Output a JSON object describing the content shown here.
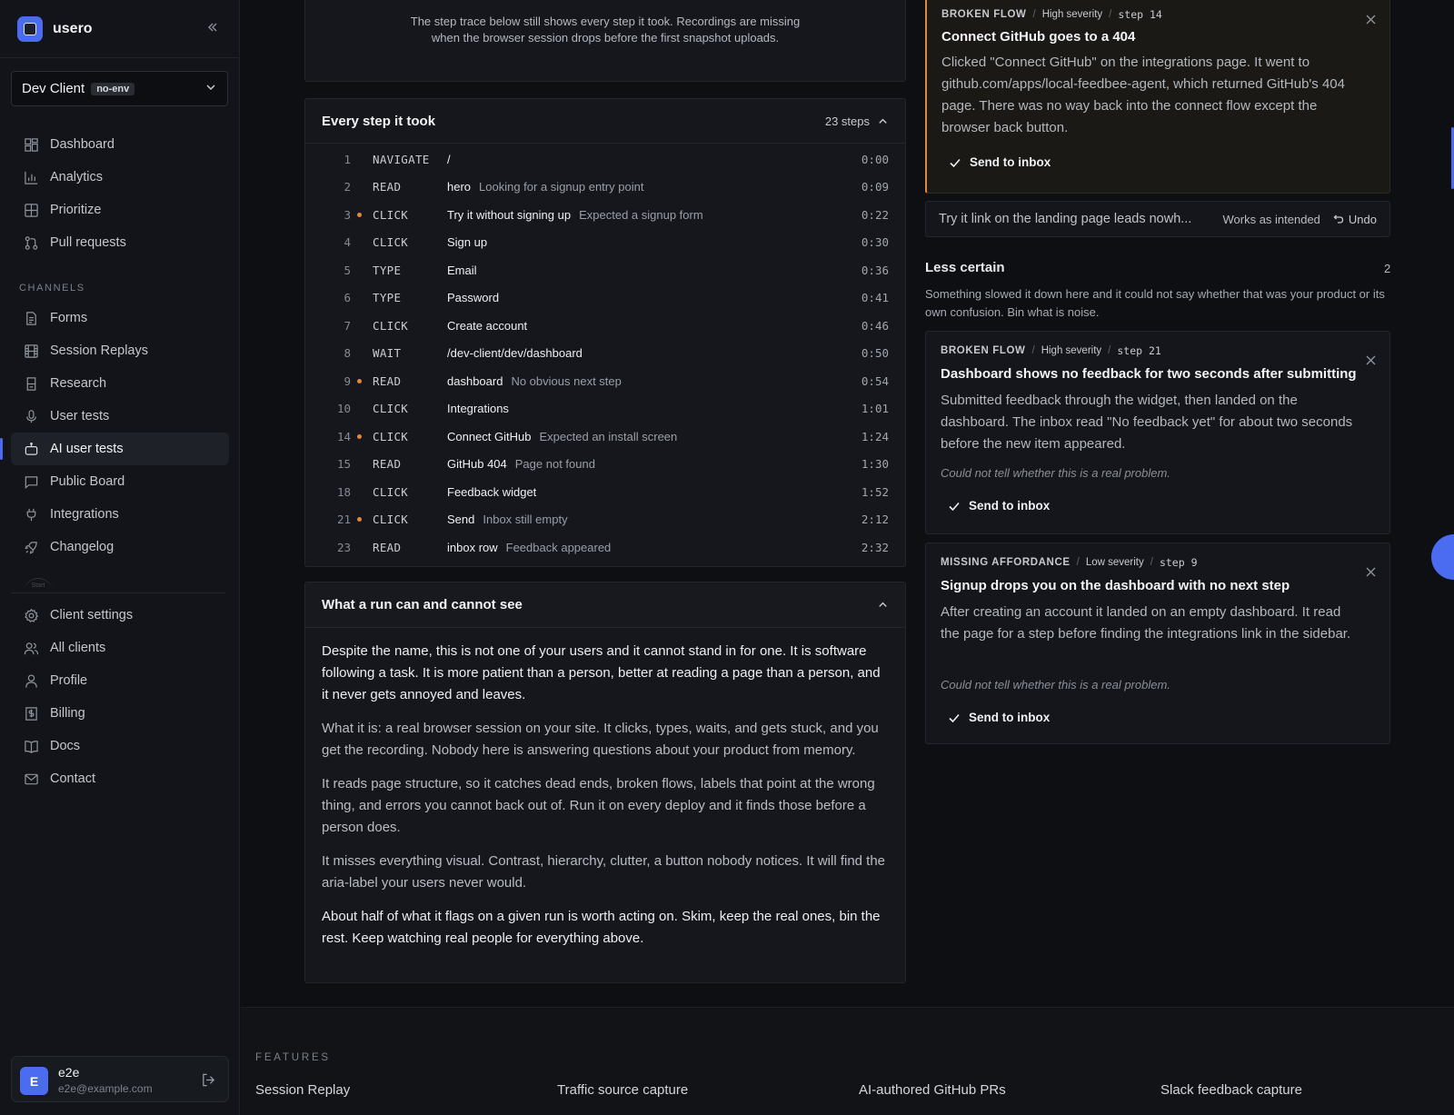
{
  "brand": {
    "name": "usero",
    "collapse_icon": "chevrons-left-icon"
  },
  "client": {
    "name": "Dev Client",
    "env": "no-env"
  },
  "nav": {
    "main": [
      {
        "label": "Dashboard",
        "icon": "dashboard-icon"
      },
      {
        "label": "Analytics",
        "icon": "bar-chart-icon"
      },
      {
        "label": "Prioritize",
        "icon": "grid-icon"
      },
      {
        "label": "Pull requests",
        "icon": "git-pull-request-icon"
      }
    ],
    "section_label": "CHANNELS",
    "channels": [
      {
        "label": "Forms",
        "icon": "form-icon"
      },
      {
        "label": "Session Replays",
        "icon": "film-icon"
      },
      {
        "label": "Research",
        "icon": "research-icon"
      },
      {
        "label": "User tests",
        "icon": "microphone-icon"
      },
      {
        "label": "AI user tests",
        "icon": "robot-icon",
        "active": true
      },
      {
        "label": "Public Board",
        "icon": "message-square-icon"
      },
      {
        "label": "Integrations",
        "icon": "plug-icon"
      },
      {
        "label": "Changelog",
        "icon": "rocket-icon"
      }
    ],
    "start_label": "Start",
    "account": [
      {
        "label": "Client settings",
        "icon": "gear-icon"
      },
      {
        "label": "All clients",
        "icon": "users-icon"
      },
      {
        "label": "Profile",
        "icon": "user-icon"
      },
      {
        "label": "Billing",
        "icon": "receipt-icon"
      },
      {
        "label": "Docs",
        "icon": "book-icon"
      },
      {
        "label": "Contact",
        "icon": "mail-icon"
      }
    ]
  },
  "user": {
    "initial": "E",
    "name": "e2e",
    "email": "e2e@example.com"
  },
  "notice": {
    "text": "The step trace below still shows every step it took. Recordings are missing when the browser session drops before the first snapshot uploads."
  },
  "steps": {
    "title": "Every step it took",
    "count": "23 steps",
    "rows": [
      {
        "num": "1",
        "flag": false,
        "action": "NAVIGATE",
        "target": "/",
        "note": "",
        "time": "0:00"
      },
      {
        "num": "2",
        "flag": false,
        "action": "READ",
        "target": "hero",
        "note": "Looking for a signup entry point",
        "time": "0:09"
      },
      {
        "num": "3",
        "flag": true,
        "action": "CLICK",
        "target": "Try it without signing up",
        "note": "Expected a signup form",
        "time": "0:22"
      },
      {
        "num": "4",
        "flag": false,
        "action": "CLICK",
        "target": "Sign up",
        "note": "",
        "time": "0:30"
      },
      {
        "num": "5",
        "flag": false,
        "action": "TYPE",
        "target": "Email",
        "note": "",
        "time": "0:36"
      },
      {
        "num": "6",
        "flag": false,
        "action": "TYPE",
        "target": "Password",
        "note": "",
        "time": "0:41"
      },
      {
        "num": "7",
        "flag": false,
        "action": "CLICK",
        "target": "Create account",
        "note": "",
        "time": "0:46"
      },
      {
        "num": "8",
        "flag": false,
        "action": "WAIT",
        "target": "/dev-client/dev/dashboard",
        "note": "",
        "time": "0:50"
      },
      {
        "num": "9",
        "flag": true,
        "action": "READ",
        "target": "dashboard",
        "note": "No obvious next step",
        "time": "0:54"
      },
      {
        "num": "10",
        "flag": false,
        "action": "CLICK",
        "target": "Integrations",
        "note": "",
        "time": "1:01"
      },
      {
        "num": "14",
        "flag": true,
        "action": "CLICK",
        "target": "Connect GitHub",
        "note": "Expected an install screen",
        "time": "1:24"
      },
      {
        "num": "15",
        "flag": false,
        "action": "READ",
        "target": "GitHub 404",
        "note": "Page not found",
        "time": "1:30"
      },
      {
        "num": "18",
        "flag": false,
        "action": "CLICK",
        "target": "Feedback widget",
        "note": "",
        "time": "1:52"
      },
      {
        "num": "21",
        "flag": true,
        "action": "CLICK",
        "target": "Send",
        "note": "Inbox still empty",
        "time": "2:12"
      },
      {
        "num": "23",
        "flag": false,
        "action": "READ",
        "target": "inbox row",
        "note": "Feedback appeared",
        "time": "2:32"
      }
    ]
  },
  "seen": {
    "title": "What a run can and cannot see",
    "paragraphs": [
      {
        "text": "Despite the name, this is not one of your users and it cannot stand in for one. It is software following a task. It is more patient than a person, better at reading a page than a person, and it never gets annoyed and leaves.",
        "strong": true
      },
      {
        "text": "What it is: a real browser session on your site. It clicks, types, waits, and gets stuck, and you get the recording. Nobody here is answering questions about your product from memory.",
        "strong": false
      },
      {
        "text": "It reads page structure, so it catches dead ends, broken flows, labels that point at the wrong thing, and errors you cannot back out of. Run it on every deploy and it finds those before a person does.",
        "strong": false
      },
      {
        "text": "It misses everything visual. Contrast, hierarchy, clutter, a button nobody notices. It will find the aria-label your users never would.",
        "strong": false
      },
      {
        "text": "About half of what it flags on a given run is worth acting on. Skim, keep the real ones, bin the rest. Keep watching real people for everything above.",
        "strong": true
      }
    ]
  },
  "findings": {
    "featured": {
      "kind": "BROKEN FLOW",
      "severity": "High severity",
      "step": "step 14",
      "title": "Connect GitHub goes to a 404",
      "body": "Clicked \"Connect GitHub\" on the integrations page. It went to github.com/apps/local-feedbee-agent, which returned GitHub's 404 page. There was no way back into the connect flow except the browser back button.",
      "action": "Send to inbox"
    },
    "dismissed": {
      "text": "Try it link on the landing page leads nowh...",
      "status": "Works as intended",
      "undo": "Undo"
    },
    "less_certain": {
      "title": "Less certain",
      "count": "2",
      "description": "Something slowed it down here and it could not say whether that was your product or its own confusion. Bin what is noise.",
      "items": [
        {
          "kind": "BROKEN FLOW",
          "severity": "High severity",
          "step": "step 21",
          "title": "Dashboard shows no feedback for two seconds after submitting",
          "body": "Submitted feedback through the widget, then landed on the dashboard. The inbox read \"No feedback yet\" for about two seconds before the new item appeared.",
          "hint": "Could not tell whether this is a real problem.",
          "action": "Send to inbox"
        },
        {
          "kind": "MISSING AFFORDANCE",
          "severity": "Low severity",
          "step": "step 9",
          "title": "Signup drops you on the dashboard with no next step",
          "body": "After creating an account it landed on an empty dashboard. It read the page for a step before finding the integrations link in the sidebar.",
          "hint": "Could not tell whether this is a real problem.",
          "action": "Send to inbox"
        }
      ]
    }
  },
  "footer": {
    "label": "FEATURES",
    "features": [
      "Session Replay",
      "Traffic source capture",
      "AI-authored GitHub PRs",
      "Slack feedback capture"
    ]
  },
  "colors": {
    "accent": "#4b6cf0",
    "warning": "#e0883c",
    "background": "#0d0f13",
    "panel": "#15171c"
  }
}
